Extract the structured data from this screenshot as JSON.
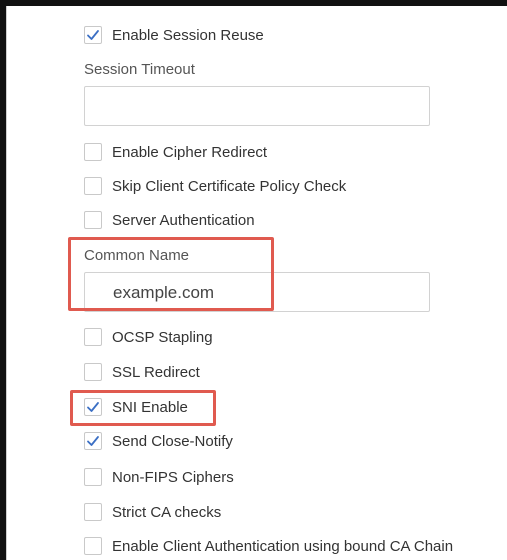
{
  "options": {
    "enable_session_reuse": {
      "label": "Enable Session Reuse",
      "checked": true
    },
    "session_timeout": {
      "label": "Session Timeout",
      "value": ""
    },
    "enable_cipher_redirect": {
      "label": "Enable Cipher Redirect",
      "checked": false
    },
    "skip_client_cert_policy": {
      "label": "Skip Client Certificate Policy Check",
      "checked": false
    },
    "server_authentication": {
      "label": "Server Authentication",
      "checked": false
    },
    "common_name": {
      "label": "Common Name",
      "value": "example.com"
    },
    "ocsp_stapling": {
      "label": "OCSP Stapling",
      "checked": false
    },
    "ssl_redirect": {
      "label": "SSL Redirect",
      "checked": false
    },
    "sni_enable": {
      "label": "SNI Enable",
      "checked": true
    },
    "send_close_notify": {
      "label": "Send Close-Notify",
      "checked": true
    },
    "non_fips_ciphers": {
      "label": "Non-FIPS Ciphers",
      "checked": false
    },
    "strict_ca_checks": {
      "label": "Strict CA checks",
      "checked": false
    },
    "enable_client_auth_ca_chain": {
      "label": "Enable Client Authentication using bound CA Chain",
      "checked": false
    }
  },
  "colors": {
    "checkmark": "#3b6fc4",
    "highlight": "#e05a4f"
  },
  "icons": {
    "checked": "checkmark-icon"
  }
}
